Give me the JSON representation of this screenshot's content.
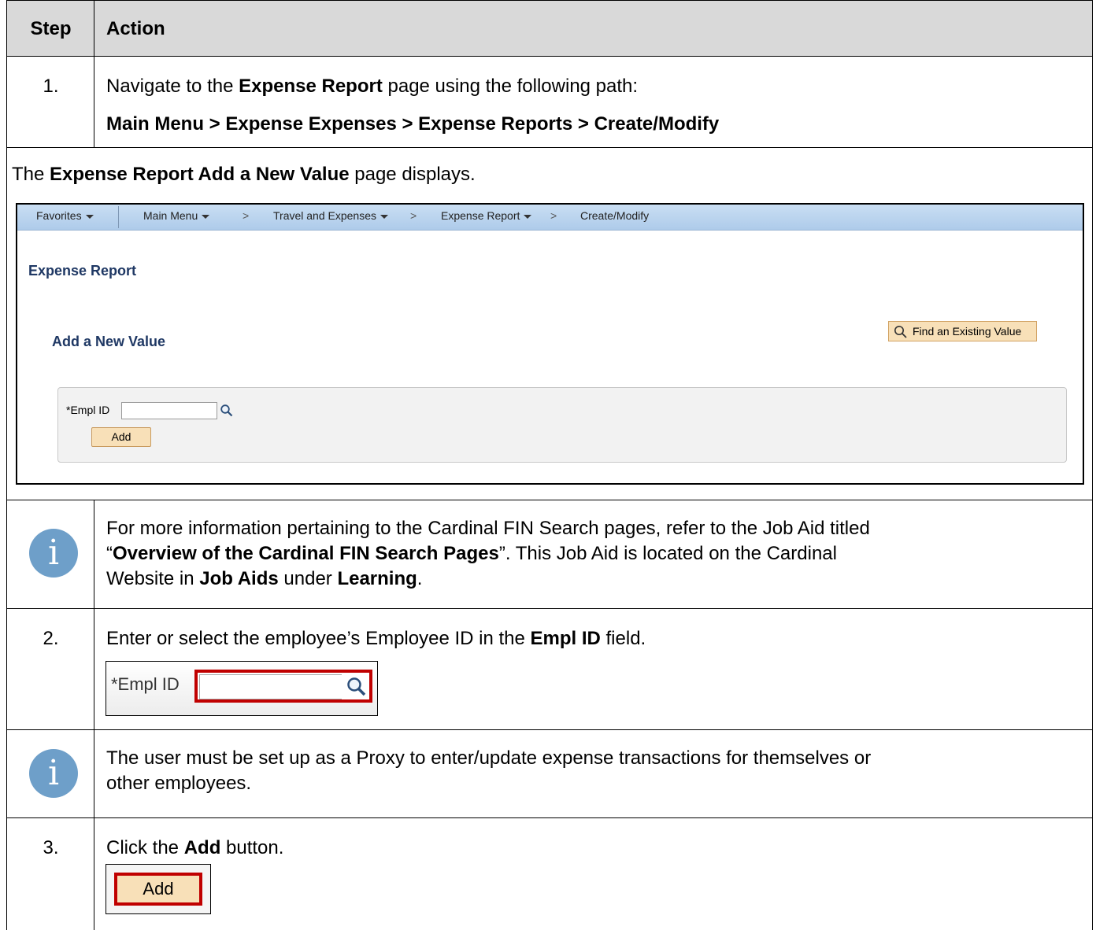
{
  "table": {
    "header": {
      "step": "Step",
      "action": "Action"
    },
    "step1": {
      "num": "1.",
      "line1": {
        "pre": "Navigate to the ",
        "bold": "Expense Report",
        "post": " page using the following path:"
      },
      "path": "Main Menu > Expense Expenses > Expense Reports > Create/Modify"
    },
    "display": {
      "pre": "The ",
      "bold": "Expense Report Add a New Value",
      "post": " page displays."
    },
    "note1": {
      "line1": "For more information pertaining to the Cardinal FIN Search pages, refer to the Job Aid titled",
      "line2_q1": "“",
      "line2_bold": "Overview of the Cardinal FIN Search Pages",
      "line2_rest": "”.  This Job Aid is located on the Cardinal",
      "line3_pre": "Website in ",
      "line3_b1": "Job Aids",
      "line3_mid": " under ",
      "line3_b2": "Learning",
      "line3_end": "."
    },
    "step2": {
      "num": "2.",
      "pre": "Enter or select the employee’s Employee ID in the ",
      "bold": "Empl ID",
      "post": " field."
    },
    "note2": {
      "line1": "The user must be set up as a Proxy to enter/update expense transactions for themselves or",
      "line2": "other employees."
    },
    "step3": {
      "num": "3.",
      "pre": "Click the ",
      "bold": "Add",
      "post": " button."
    }
  },
  "screenshot": {
    "nav": {
      "favorites": "Favorites",
      "main_menu": "Main Menu",
      "sep": ">",
      "travel": "Travel and Expenses",
      "expense_report": "Expense Report",
      "create_modify": "Create/Modify"
    },
    "page_title": "Expense Report",
    "sub_title": "Add a New Value",
    "find_button": "Find an Existing Value",
    "empl_label": "*Empl ID",
    "add_button": "Add"
  },
  "zoom": {
    "empl_label": "*Empl ID",
    "add_button": "Add"
  },
  "icons": {
    "info": "info-icon",
    "search": "magnifier-icon",
    "caret": "caret-down-icon"
  },
  "colors": {
    "header_bg": "#d9d9d9",
    "info_blue": "#6e9fc9",
    "nav_blue": "#b9d3ee",
    "title_navy": "#1f3864",
    "button_tan": "#f8e0b8",
    "highlight_red": "#c00000"
  }
}
